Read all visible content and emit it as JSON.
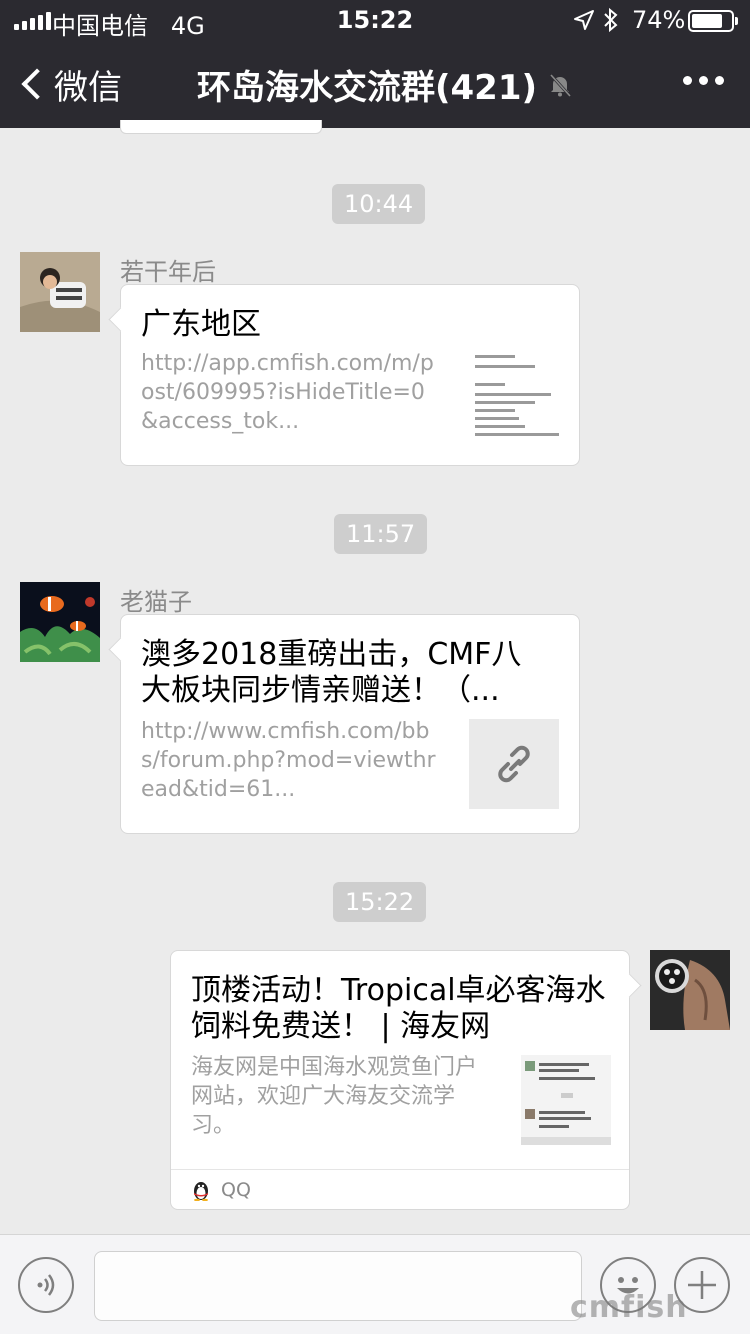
{
  "status_bar": {
    "carrier": "中国电信",
    "network": "4G",
    "time": "15:22",
    "battery_percent": "74%",
    "battery_level": 0.74
  },
  "header": {
    "back_label": "微信",
    "title": "环岛海水交流群(421)",
    "background": "#2b2a30"
  },
  "messages": {
    "ts1": "10:44",
    "msg1": {
      "sender": "若干年后",
      "title": "广东地区",
      "desc": "http://app.cmfish.com/m/post/609995?isHideTitle=0&access_tok..."
    },
    "ts2": "11:57",
    "msg2": {
      "sender": "老猫子",
      "title": "澳多2018重磅出击，CMF八大板块同步情亲赠送！（...",
      "desc": "http://www.cmfish.com/bbs/forum.php?mod=viewthread&tid=61...",
      "thumb_icon": "link-icon"
    },
    "ts3": "15:22",
    "msg3": {
      "title": "顶楼活动！Tropical卓必客海水饲料免费送！ | 海友网",
      "desc": "海友网是中国海水观赏鱼门户网站，欢迎广大海友交流学习。",
      "source": "QQ",
      "source_icon": "qq-penguin-icon"
    }
  },
  "input_bar": {
    "voice_icon": "voice-icon",
    "emoji_icon": "emoji-icon",
    "plus_icon": "plus-icon"
  },
  "watermark": "cmfish"
}
